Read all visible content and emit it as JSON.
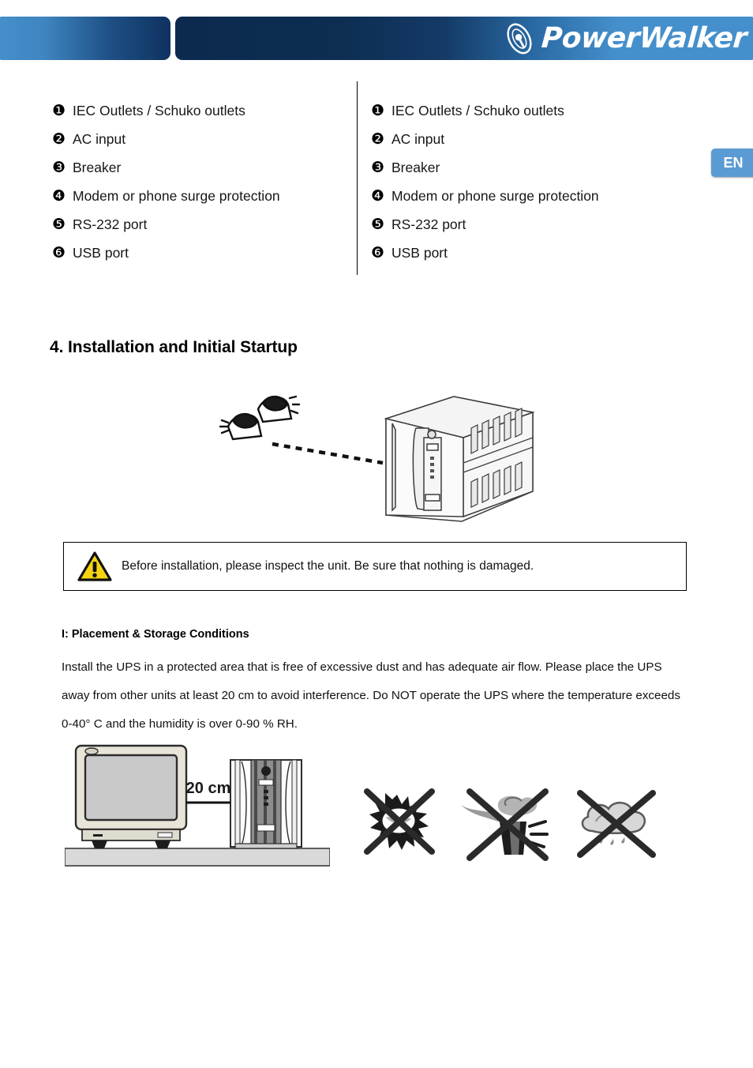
{
  "header": {
    "brand_name": "PowerWalker",
    "logo_mark": "powerwalker-oval-icon",
    "colors": {
      "light_blue": "#4590cc",
      "dark_navy": "#0d2d52"
    }
  },
  "language_badge": {
    "label": "EN",
    "color": "#5a9bd3"
  },
  "legend": {
    "divider": true,
    "column_left": [
      {
        "num": "❶",
        "label": "IEC Outlets / Schuko outlets"
      },
      {
        "num": "❷",
        "label": "AC input"
      },
      {
        "num": "❸",
        "label": "Breaker"
      },
      {
        "num": "❹",
        "label": "Modem or phone surge protection"
      },
      {
        "num": "❺",
        "label": "RS-232 port"
      },
      {
        "num": "❻",
        "label": "USB port"
      }
    ],
    "column_right": [
      {
        "num": "❶",
        "label": "IEC Outlets / Schuko outlets"
      },
      {
        "num": "❷",
        "label": "AC input"
      },
      {
        "num": "❸",
        "label": "Breaker"
      },
      {
        "num": "❹",
        "label": "Modem or phone surge protection"
      },
      {
        "num": "❺",
        "label": "RS-232 port"
      },
      {
        "num": "❻",
        "label": "USB port"
      }
    ]
  },
  "section": {
    "heading": "4. Installation and Initial Startup"
  },
  "figures": {
    "inspect_figure": "eyes-inspecting-ups-illustration",
    "spacing_figure": "monitor-and-ups-spacing-illustration",
    "spacing_label": "20 cm",
    "prohibit_figure": "prohibited-conditions-illustration",
    "prohibit_items": [
      "no-direct-sunlight-icon",
      "no-smoke-or-chemical-vapour-icon",
      "no-rain-or-moisture-icon"
    ]
  },
  "warning": {
    "icon": "warning-triangle-icon",
    "icon_color": "#f5d311",
    "text": "Before installation, please inspect the unit. Be sure that nothing is damaged."
  },
  "body": {
    "heading": "I: Placement & Storage Conditions",
    "paragraph": "Install the UPS in a protected area that is free of excessive dust and has adequate air flow. Please place the UPS away from other units at least 20 cm to avoid interference. Do NOT operate the UPS where the temperature exceeds 0-40° C and the humidity is over 0-90 % RH."
  }
}
